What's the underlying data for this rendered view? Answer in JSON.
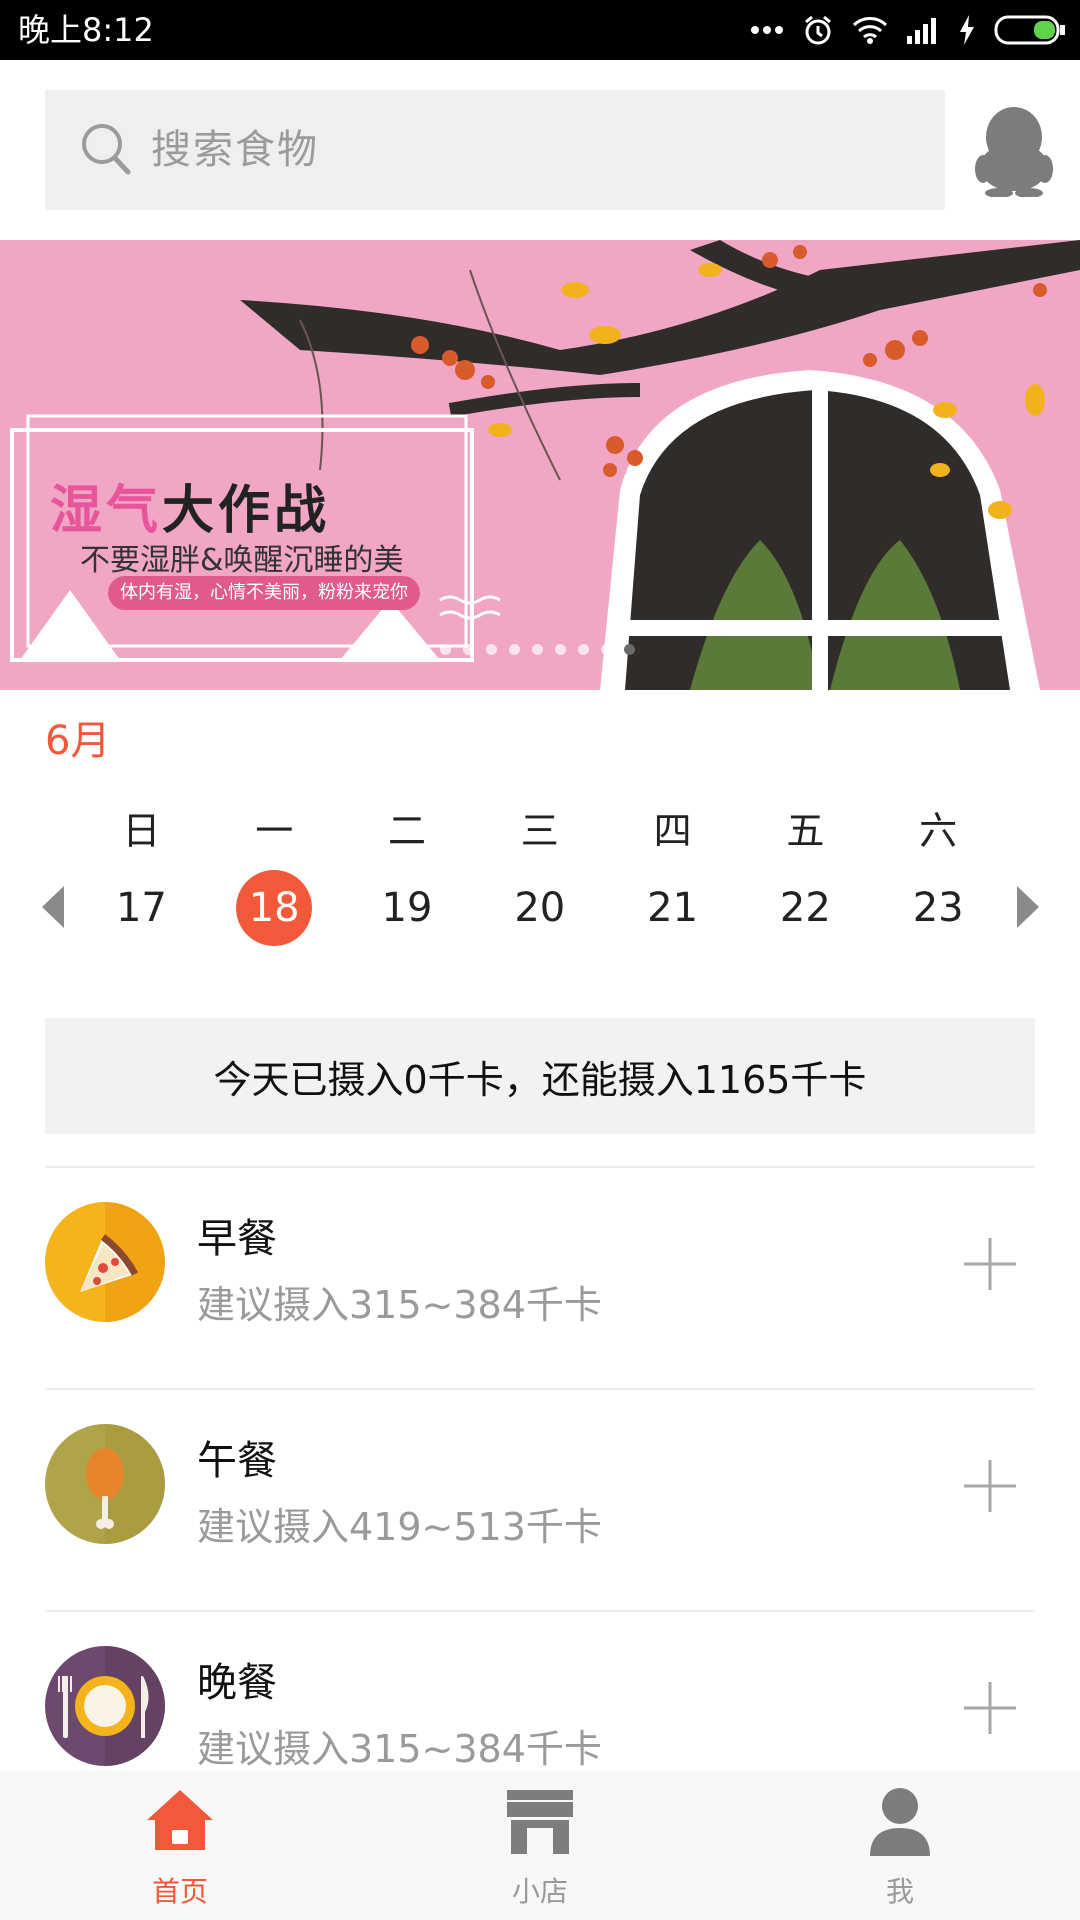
{
  "status_bar": {
    "time": "晚上8:12"
  },
  "search": {
    "placeholder": "搜索食物"
  },
  "banner": {
    "title_part1": "湿",
    "title_part2": "气",
    "title_part3": "大作战",
    "subtitle": "不要湿胖&唤醒沉睡的美",
    "tagline": "体内有湿，心情不美丽，粉粉来宠你",
    "page_count": 9,
    "active_page": 8
  },
  "calendar": {
    "month": "6月",
    "weekdays": [
      "日",
      "一",
      "二",
      "三",
      "四",
      "五",
      "六"
    ],
    "dates": [
      "17",
      "18",
      "19",
      "20",
      "21",
      "22",
      "23"
    ],
    "selected_date": "18"
  },
  "summary": "今天已摄入0千卡，还能摄入1165千卡",
  "meals": [
    {
      "name": "早餐",
      "hint": "建议摄入315~384千卡",
      "icon": "pizza-icon",
      "color": "#f5b31c"
    },
    {
      "name": "午餐",
      "hint": "建议摄入419~513千卡",
      "icon": "drumstick-icon",
      "color": "#b0a44a"
    },
    {
      "name": "晚餐",
      "hint": "建议摄入315~384千卡",
      "icon": "plate-icon",
      "color": "#6d4a6d"
    }
  ],
  "tabs": [
    {
      "label": "首页",
      "icon": "home-icon",
      "active": true
    },
    {
      "label": "小店",
      "icon": "shop-icon",
      "active": false
    },
    {
      "label": "我",
      "icon": "person-icon",
      "active": false
    }
  ],
  "colors": {
    "accent": "#f2593a",
    "banner_bg": "#f1a6c6"
  }
}
